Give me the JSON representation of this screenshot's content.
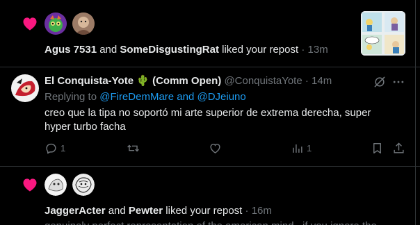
{
  "notifications": [
    {
      "users": [
        "Agus 7531",
        "SomeDisgustingRat"
      ],
      "connector": "and",
      "action": "liked your repost",
      "time": "13m"
    },
    {
      "users": [
        "JaggerActer",
        "Pewter"
      ],
      "connector": "and",
      "action": "liked your repost",
      "time": "16m",
      "preview": "genuinely perfect representation of the american mind , if you ignore the"
    }
  ],
  "tweet": {
    "display_name": "El Conquista-Yote",
    "emoji": "🌵",
    "name_suffix": "(Comm Open)",
    "handle": "@ConquistaYote",
    "time": "14m",
    "separator": "·",
    "replying_to_label": "Replying to",
    "replying_to": "@FireDemMare and @DJeiuno",
    "text": "creo que la tipa no soportó mi arte superior de extrema derecha, super hyper turbo facha",
    "reply_count": "1",
    "retweet_count": "",
    "like_count": "",
    "view_count": "1"
  },
  "colors": {
    "heart": "#f91880",
    "link": "#1d9bf0",
    "muted": "#71767b",
    "divider": "#2f3336"
  },
  "icons": [
    "heart-icon",
    "grok-icon",
    "more-icon",
    "reply-icon",
    "retweet-icon",
    "like-icon",
    "views-icon",
    "bookmark-icon",
    "share-icon"
  ]
}
